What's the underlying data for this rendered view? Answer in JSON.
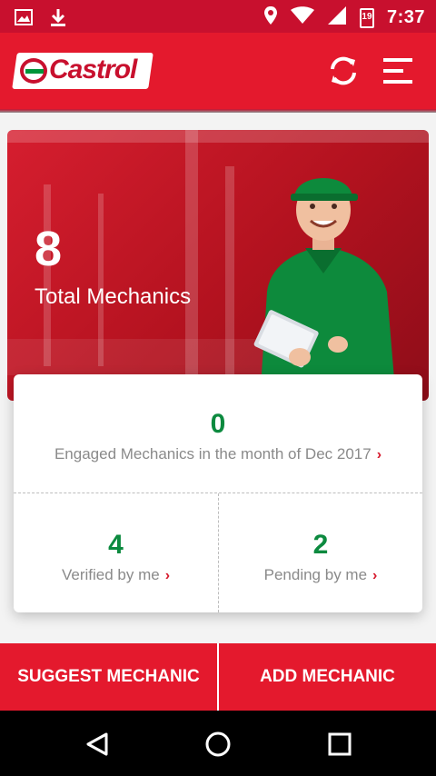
{
  "status_bar": {
    "time": "7:37",
    "calendar_day": "19",
    "icons": [
      "image-icon",
      "download-icon",
      "location-icon",
      "wifi-icon",
      "signal-icon",
      "calendar-icon"
    ]
  },
  "app_bar": {
    "logo_text": "Castrol",
    "icons": [
      "refresh-icon",
      "menu-icon"
    ]
  },
  "hero": {
    "count": "8",
    "label": "Total Mechanics"
  },
  "stats": {
    "engaged": {
      "value": "0",
      "label": "Engaged Mechanics in the month of Dec 2017"
    },
    "verified": {
      "value": "4",
      "label": "Verified by me"
    },
    "pending": {
      "value": "2",
      "label": "Pending by me"
    }
  },
  "actions": {
    "suggest_label": "SUGGEST MECHANIC",
    "add_label": "ADD MECHANIC"
  },
  "nav": {
    "icons": [
      "back-icon",
      "home-icon",
      "recents-icon"
    ]
  },
  "colors": {
    "brand_red": "#e4192d",
    "stat_green": "#0c8a3f"
  }
}
